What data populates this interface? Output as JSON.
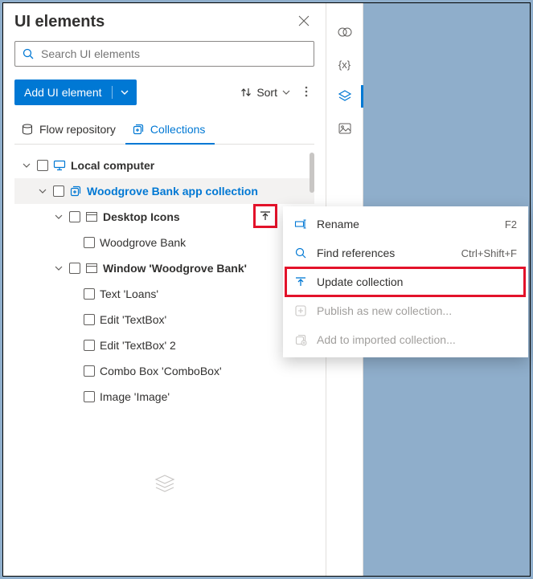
{
  "panel": {
    "title": "UI elements",
    "search_placeholder": "Search UI elements",
    "add_button": "Add UI element",
    "sort_label": "Sort",
    "tabs": {
      "flow": "Flow repository",
      "collections": "Collections"
    }
  },
  "tree": {
    "root": "Local computer",
    "collection": "Woodgrove Bank app collection",
    "groups": [
      {
        "label": "Desktop Icons",
        "items": [
          "Woodgrove Bank"
        ]
      },
      {
        "label": "Window 'Woodgrove Bank'",
        "items": [
          "Text 'Loans'",
          "Edit 'TextBox'",
          "Edit 'TextBox' 2",
          "Combo Box 'ComboBox'",
          "Image 'Image'"
        ]
      }
    ]
  },
  "context_menu": {
    "rename": "Rename",
    "rename_shortcut": "F2",
    "find": "Find references",
    "find_shortcut": "Ctrl+Shift+F",
    "update": "Update collection",
    "publish": "Publish as new collection...",
    "add_to": "Add to imported collection..."
  }
}
